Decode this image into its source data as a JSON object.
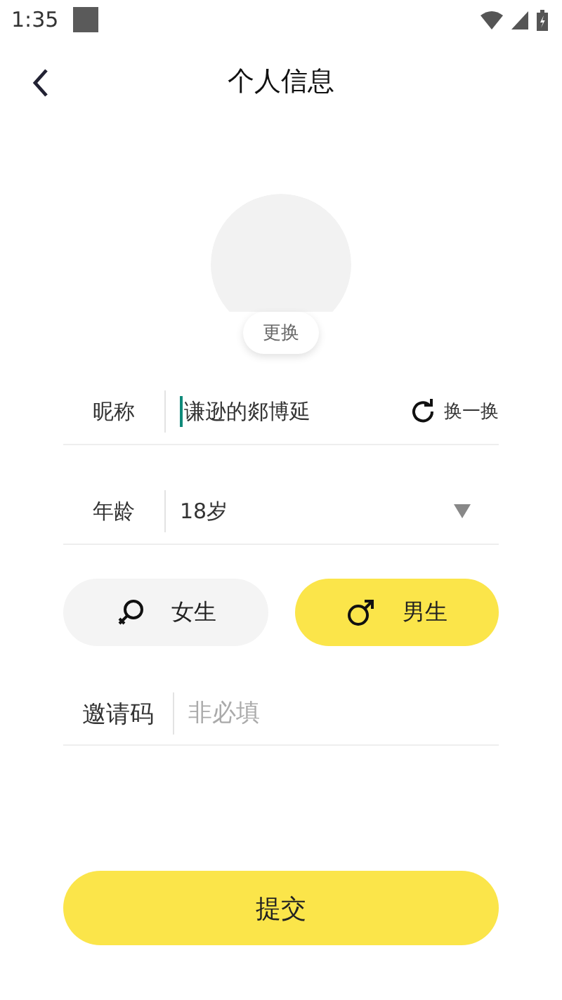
{
  "status_bar": {
    "time": "1:35"
  },
  "header": {
    "title": "个人信息"
  },
  "avatar": {
    "change_label": "更换"
  },
  "nickname": {
    "label": "昵称",
    "value": "谦逊的郯博延",
    "focused": true,
    "shuffle_label": "换一换"
  },
  "age": {
    "label": "年龄",
    "value": "18岁"
  },
  "genders": [
    {
      "kind": "female",
      "label": "女生",
      "selected": false
    },
    {
      "kind": "male",
      "label": "男生",
      "selected": true
    }
  ],
  "invite": {
    "label": "邀请码",
    "placeholder": "非必填"
  },
  "submit": {
    "label": "提交"
  }
}
